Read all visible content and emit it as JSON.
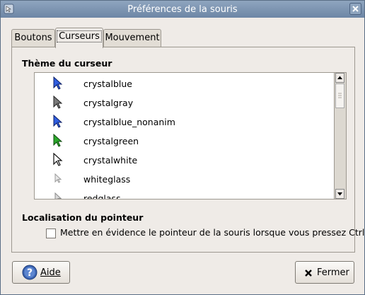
{
  "window": {
    "title": "Préférences de la souris"
  },
  "tabs": [
    {
      "label": "Boutons",
      "active": false
    },
    {
      "label": "Curseurs",
      "active": true
    },
    {
      "label": "Mouvement",
      "active": false
    }
  ],
  "cursor_theme": {
    "heading": "Thème du curseur",
    "items": [
      {
        "label": "crystalblue",
        "icon": "blue-arrow-cursor-icon",
        "color": "#2f5ee0"
      },
      {
        "label": "crystalgray",
        "icon": "gray-arrow-cursor-icon",
        "color": "#7a7a7a"
      },
      {
        "label": "crystalblue_nonanim",
        "icon": "blue-arrow-cursor-icon",
        "color": "#2f5ee0"
      },
      {
        "label": "crystalgreen",
        "icon": "green-arrow-cursor-icon",
        "color": "#2aa82a"
      },
      {
        "label": "crystalwhite",
        "icon": "white-arrow-cursor-icon",
        "color": "#ffffff"
      },
      {
        "label": "whiteglass",
        "icon": "whiteglass-arrow-cursor-icon",
        "color": "#e0e0e0"
      },
      {
        "label": "redglass",
        "icon": "redglass-arrow-cursor-icon",
        "color": "#d8d8d8"
      }
    ]
  },
  "pointer_location": {
    "heading": "Localisation du pointeur",
    "checkbox_label": "Mettre en évidence le pointeur de la souris lorsque vous pressez Ctrl",
    "checked": false
  },
  "buttons": {
    "help_label": "Aide",
    "close_label": "Fermer"
  },
  "colors": {
    "titlebar": "#7b93b1",
    "window_bg": "#efebe7"
  }
}
